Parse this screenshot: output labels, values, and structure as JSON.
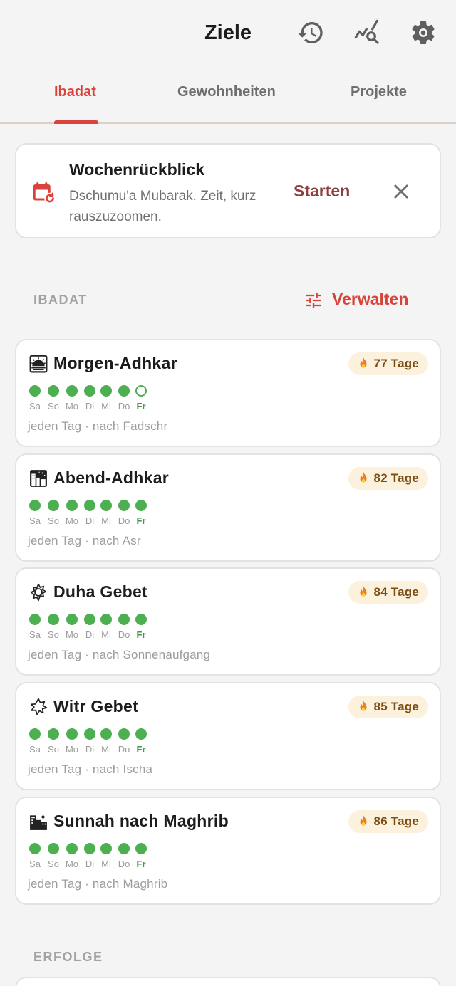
{
  "header": {
    "title": "Ziele",
    "icons": [
      "history-icon",
      "stats-search-icon",
      "settings-icon"
    ]
  },
  "tabs": [
    {
      "label": "Ibadat",
      "active": true
    },
    {
      "label": "Gewohnheiten",
      "active": false
    },
    {
      "label": "Projekte",
      "active": false
    }
  ],
  "review": {
    "title": "Wochenrückblick",
    "subtitle": "Dschumu'a Mubarak. Zeit, kurz rauszuzoomen.",
    "start_label": "Starten",
    "icon": "calendar-refresh-icon"
  },
  "section": {
    "label": "IBADAT",
    "manage_label": "Verwalten"
  },
  "days": [
    "Sa",
    "So",
    "Mo",
    "Di",
    "Mi",
    "Do",
    "Fr"
  ],
  "habits": [
    {
      "name": "Morgen-Adhkar",
      "streak": "77 Tage",
      "meta": "jeden Tag · nach Fadschr",
      "icon": "sunrise-icon",
      "done": [
        true,
        true,
        true,
        true,
        true,
        true,
        false
      ]
    },
    {
      "name": "Abend-Adhkar",
      "streak": "82 Tage",
      "meta": "jeden Tag · nach Asr",
      "icon": "night-city-icon",
      "done": [
        true,
        true,
        true,
        true,
        true,
        true,
        true
      ]
    },
    {
      "name": "Duha Gebet",
      "streak": "84 Tage",
      "meta": "jeden Tag · nach Sonnenaufgang",
      "icon": "sun-icon",
      "done": [
        true,
        true,
        true,
        true,
        true,
        true,
        true
      ]
    },
    {
      "name": "Witr Gebet",
      "streak": "85 Tage",
      "meta": "jeden Tag · nach Ischa",
      "icon": "star-burst-icon",
      "done": [
        true,
        true,
        true,
        true,
        true,
        true,
        true
      ]
    },
    {
      "name": "Sunnah nach Maghrib",
      "streak": "86 Tage",
      "meta": "jeden Tag · nach Maghrib",
      "icon": "city-dusk-icon",
      "done": [
        true,
        true,
        true,
        true,
        true,
        true,
        true
      ]
    }
  ],
  "achievements": {
    "label": "ERFOLGE"
  },
  "colors": {
    "accent": "#d8433b",
    "success": "#4caf50",
    "streak_bg": "#fcf1dc",
    "start": "#8e3f3f"
  }
}
